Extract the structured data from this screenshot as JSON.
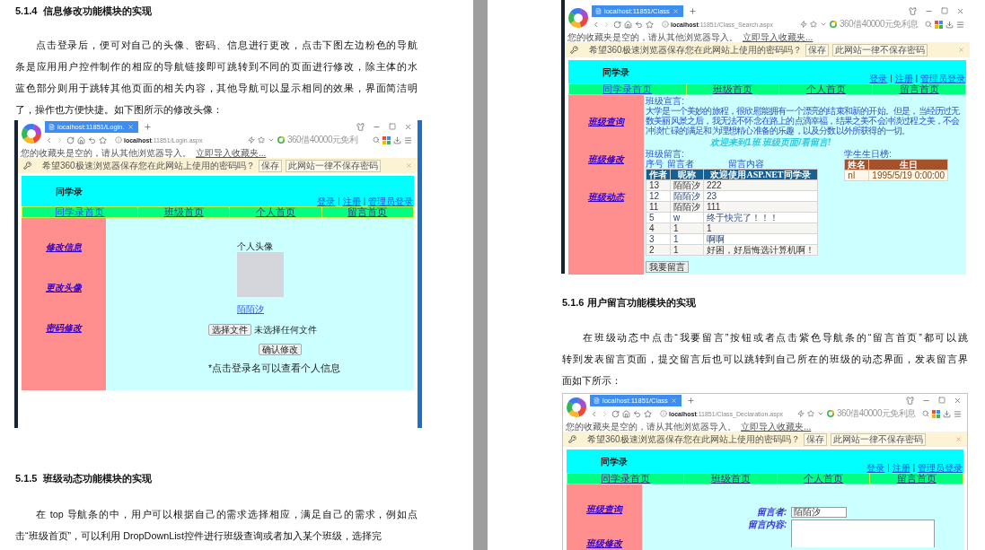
{
  "left_page": {
    "heading": "5.1.4  信息修改功能模块的实现",
    "paragraph": {
      "lines": [
        "点击登录后，便可对自己的头像、密码、信息进行更改，点击下图左边粉色的导航",
        "条是应用用户控件制作的相应的导航链接即可跳转到不同的页面进行修改，除主体的水",
        "蓝色部分则用于跳转其他页面的相关内容，其他导航可以显示相同的效果，界面简洁明",
        "了，操作也方便快捷。如下图所示的修改头像："
      ]
    },
    "screenshot": {
      "browser": {
        "tab_title": "localhost:11851/Login.",
        "address_host": "localhost",
        "address_path": ":11851/Login.aspx",
        "search_placeholder": "360借40000元免利",
        "bookmarks_text": "您的收藏夹是空的，请从其他浏览器导入。",
        "bookmarks_link": "立即导入收藏夹...",
        "password_prompt": "希望360极速浏览器保存您在此网站上使用的密码吗？",
        "password_buttons": [
          "保存",
          "此网站一律不保存密码"
        ]
      },
      "site": {
        "title": "同学录",
        "top_links": [
          {
            "kind": "link",
            "label": "登录"
          },
          {
            "kind": "separator",
            "label": "|"
          },
          {
            "kind": "link",
            "label": "注册"
          },
          {
            "kind": "separator",
            "label": "|"
          },
          {
            "kind": "link",
            "label": "管理员登录"
          }
        ],
        "nav": [
          {
            "label": "同学录首页",
            "visited": false
          },
          {
            "label": "班级首页",
            "visited": true
          },
          {
            "label": "个人首页",
            "visited": true
          },
          {
            "label": "留言首页",
            "visited": true
          }
        ],
        "side_links": [
          "修改信息",
          "更改头像",
          "密码修改"
        ],
        "content": {
          "kind": "profile",
          "avatar_label": "个人头像",
          "username": "陌陌汐",
          "file_button": "选择文件",
          "file_status": "未选择任何文件",
          "submit": "确认修改",
          "hint": "*点击登录名可以查看个人信息"
        }
      }
    },
    "heading_2": "5.1.5  班级动态功能模块的实现",
    "paragraph_2": {
      "lines": [
        "在 top 导航条的中，用户可以根据自己的需求选择相应，满足自己的需求，例如点",
        "击“班级首页”，可以利用 DropDownList控件进行班级查询或者加入某个班级，选择完"
      ]
    }
  },
  "right_page": {
    "screenshot": {
      "browser": {
        "tab_title": "localhost:11851/Class",
        "address_host": "localhost",
        "address_path": ":11851/Class_Search.aspx",
        "search_placeholder": "360借40000元免利息",
        "bookmarks_text": "您的收藏夹是空的，请从其他浏览器导入。",
        "bookmarks_link": "立即导入收藏夹...",
        "password_prompt": "希望360极速浏览器保存您在此网站上使用的密码吗？",
        "password_buttons": [
          "保存",
          "此网站一律不保存密码"
        ]
      },
      "site": {
        "title": "同学录",
        "top_links": [
          {
            "kind": "link",
            "label": "登录"
          },
          {
            "kind": "separator",
            "label": "|"
          },
          {
            "kind": "link",
            "label": "注册"
          },
          {
            "kind": "separator",
            "label": "|"
          },
          {
            "kind": "link",
            "label": "管理员登录"
          }
        ],
        "nav": [
          {
            "label": "同学录首页",
            "visited": false
          },
          {
            "label": "班级首页",
            "visited": true
          },
          {
            "label": "个人首页",
            "visited": true
          },
          {
            "label": "留言首页",
            "visited": true
          }
        ],
        "side_links": [
          "班级查询",
          "班级修改",
          "班级动态"
        ],
        "content": {
          "kind": "class_search",
          "motto_label": "班级宣言:",
          "motto": "大学是一个美妙的旅程，很欣慰能拥有一个漂亮的结束和新的开始。但是，当经历过无数美丽风景之后，我无法不怀念在路上的点滴幸福，结果之美不会冲淡过程之美，不会冲淡忙碌的满足和为理想精心准备的乐趣，以及分数以外所获得的一切。",
          "welcome": "欢迎来到1班 班级页面/看留言!",
          "messages_label": "班级留言:",
          "list_header": [
            "序号",
            "留言者",
            "留言内容"
          ],
          "messages_table": {
            "columns": [
              "作者",
              "昵称",
              "欢迎使用ASP.NET同学录"
            ],
            "rows": [
              [
                "13",
                "陌陌汐",
                "222"
              ],
              [
                "12",
                "陌陌汐",
                "23"
              ],
              [
                "11",
                "陌陌汐",
                "111"
              ],
              [
                "5",
                "w",
                "终于快完了！！！"
              ],
              [
                "4",
                "1",
                "1"
              ],
              [
                "3",
                "1",
                "啊啊"
              ],
              [
                "2",
                "1",
                "好困，好后悔选计算机啊！"
              ]
            ]
          },
          "birthday_label": "学生生日榜:",
          "birthday_table": {
            "columns": [
              "姓名",
              "生日"
            ],
            "rows": [
              [
                "nl",
                "1995/5/19 0:00:00"
              ]
            ]
          },
          "button": "我要留言"
        }
      }
    },
    "heading": "5.1.6 用户留言功能模块的实现",
    "paragraph": {
      "lines": [
        "在班级动态中点击“我要留言”按钮或者点击紫色导航条的“留言首页”都可以跳",
        "转到发表留言页面，提交留言后也可以跳转到自己所在的班级的动态界面，发表留言界",
        "面如下所示："
      ]
    },
    "screenshot_2": {
      "browser": {
        "tab_title": "localhost:11851/Class",
        "address_host": "localhost",
        "address_path": ":11851/Class_Declaration.aspx",
        "search_placeholder": "360借40000元免利息",
        "bookmarks_text": "您的收藏夹是空的，请从其他浏览器导入。",
        "bookmarks_link": "立即导入收藏夹...",
        "password_prompt": "希望360极速浏览器保存您在此网站上使用的密码吗？",
        "password_buttons": [
          "保存",
          "此网站一律不保存密码"
        ]
      },
      "site": {
        "title": "同学录",
        "top_links": [
          {
            "kind": "link",
            "label": "登录"
          },
          {
            "kind": "separator",
            "label": "|"
          },
          {
            "kind": "link",
            "label": "注册"
          },
          {
            "kind": "separator",
            "label": "|"
          },
          {
            "kind": "link",
            "label": "管理员登录"
          }
        ],
        "nav": [
          {
            "label": "同学录首页",
            "visited": true
          },
          {
            "label": "班级首页",
            "visited": true
          },
          {
            "label": "个人首页",
            "visited": true
          },
          {
            "label": "留言首页",
            "visited": true
          }
        ],
        "side_links": [
          "班级查询",
          "班级修改"
        ],
        "content": {
          "kind": "declaration",
          "fields": [
            {
              "kind": "input",
              "label": "留言者:",
              "value": "陌陌汐"
            },
            {
              "kind": "textarea",
              "label": "留言内容:"
            }
          ]
        }
      }
    }
  }
}
